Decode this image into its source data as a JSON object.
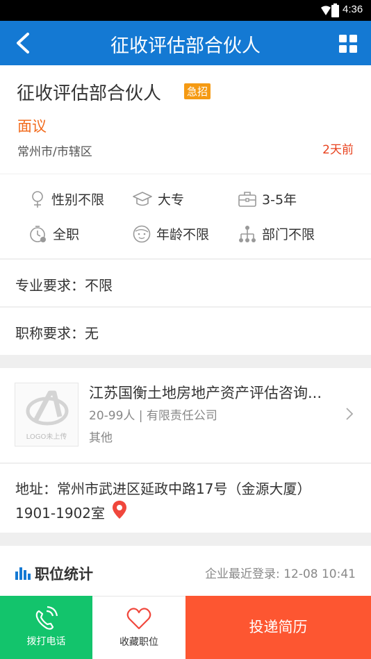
{
  "status_bar": {
    "time": "4:36"
  },
  "app_bar": {
    "title": "征收评估部合伙人"
  },
  "job": {
    "title": "征收评估部合伙人",
    "badge": "急招",
    "salary": "面议",
    "location": "常州市/市辖区",
    "posted": "2天前"
  },
  "attributes": [
    {
      "icon": "gender-icon",
      "label": "性别不限"
    },
    {
      "icon": "education-cap-icon",
      "label": "大专"
    },
    {
      "icon": "briefcase-icon",
      "label": "3-5年"
    },
    {
      "icon": "clock-icon",
      "label": "全职"
    },
    {
      "icon": "face-icon",
      "label": "年龄不限"
    },
    {
      "icon": "org-chart-icon",
      "label": "部门不限"
    }
  ],
  "requirements": {
    "major": "专业要求：不限",
    "title": "职称要求：无"
  },
  "company": {
    "logo_text": "LOGO未上传",
    "name": "江苏国衡土地房地产资产评估咨询...",
    "size": "20-99人 | 有限责任公司",
    "industry": "其他"
  },
  "address": {
    "line1": "地址：常州市武进区延政中路17号（金源大厦）",
    "line2": "1901-1902室"
  },
  "stats": {
    "title": "职位统计",
    "last_login": "企业最近登录: 12-08 10:41"
  },
  "bottom_bar": {
    "call": "拨打电话",
    "favorite": "收藏职位",
    "apply": "投递简历"
  },
  "colors": {
    "primary": "#1479d3",
    "call": "#13c46c",
    "apply": "#fd5631",
    "salary": "#f26b1d",
    "badge": "#f59a13"
  }
}
